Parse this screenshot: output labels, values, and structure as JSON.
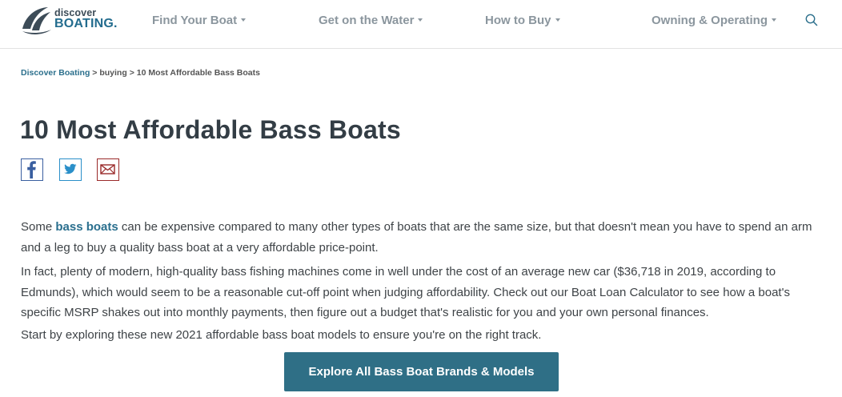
{
  "header": {
    "logo": {
      "top_text": "discover",
      "bottom_text": "BOATING."
    },
    "nav": [
      {
        "label": "Find Your Boat"
      },
      {
        "label": "Get on the Water"
      },
      {
        "label": "How to Buy"
      },
      {
        "label": "Owning & Operating"
      }
    ],
    "search_icon": "search-icon"
  },
  "breadcrumb": {
    "items": [
      "Discover Boating",
      "buying",
      "10 Most Affordable Bass Boats"
    ],
    "separator": ">"
  },
  "article": {
    "title": "10 Most Affordable Bass Boats",
    "share": [
      {
        "icon": "facebook-icon",
        "color": "#3a5fa0"
      },
      {
        "icon": "twitter-icon",
        "color": "#2a8fc9"
      },
      {
        "icon": "email-icon",
        "color": "#9a2a2a"
      }
    ],
    "p1": {
      "before": "Some ",
      "link": "bass boats",
      "after": " can be expensive compared to many other types of boats that are the same size, but that doesn't mean you have to spend an arm and a leg to buy a quality bass boat at a very affordable price-point."
    },
    "p2": "In fact, plenty of modern, high-quality bass fishing machines come in well under the cost of an average new car ($36,718 in 2019, according to Edmunds), which would seem to be a reasonable cut-off point when judging affordability. Check out our Boat Loan Calculator to see how a boat's specific MSRP shakes out into monthly payments, then figure out a budget that's realistic for you and your own personal finances.",
    "p3": "Start by exploring these new 2021 affordable bass boat models to ensure you're on the right track.",
    "cta": "Explore All Bass Boat Brands & Models"
  },
  "colors": {
    "brand_blue": "#236c8e",
    "nav_gray": "#8b969e",
    "cta_bg": "#2f6f86",
    "title_text": "#333d45"
  }
}
